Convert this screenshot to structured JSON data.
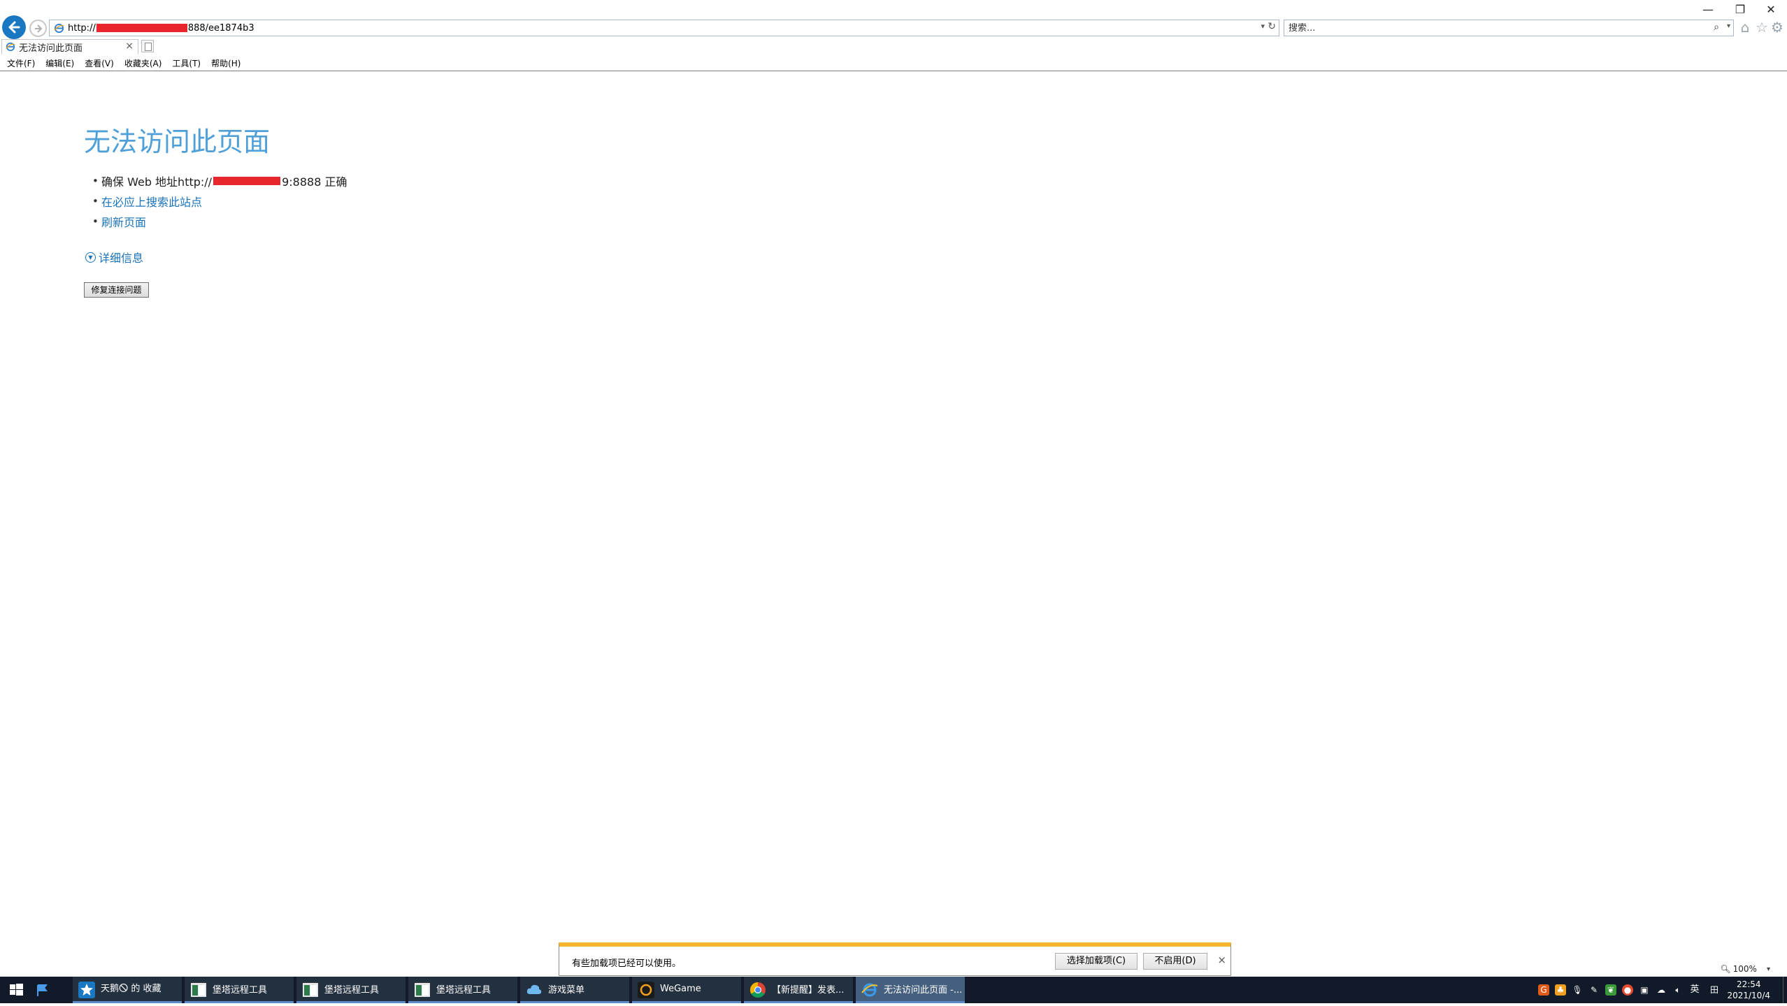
{
  "window": {
    "minimize": "—",
    "restore": "❐",
    "close": "✕"
  },
  "address_bar": {
    "url_prefix": "http://",
    "url_suffix": "888/ee1874b3"
  },
  "search": {
    "placeholder": "搜索..."
  },
  "tab": {
    "title": "无法访问此页面",
    "close": "×"
  },
  "menu": [
    "文件(F)",
    "编辑(E)",
    "查看(V)",
    "收藏夹(A)",
    "工具(T)",
    "帮助(H)"
  ],
  "content": {
    "title": "无法访问此页面",
    "bullet_1_prefix": "确保 Web 地址http://",
    "bullet_1_suffix": "9:8888 正确",
    "bullet_2": "在必应上搜索此站点",
    "bullet_3": "刷新页面",
    "details": "详细信息",
    "fix_button": "修复连接问题"
  },
  "zoom": {
    "label": "100%"
  },
  "notification": {
    "text": "有些加载项已经可以使用。",
    "choose_button": "选择加载项(C)",
    "disable_button": "不启用(D)",
    "close": "×"
  },
  "taskbar": {
    "tasks": [
      "天鹅🛇 的 收藏",
      "堡塔远程工具",
      "堡塔远程工具",
      "堡塔远程工具",
      "游戏菜单",
      "WeGame",
      "【新提醒】发表...",
      "无法访问此页面 -..."
    ],
    "tray_lang": "英",
    "time": "22:54",
    "date": "2021/10/4"
  },
  "colors": {
    "accent": "#1a78c2",
    "title_blue": "#4f9fd8",
    "link_blue": "#1a73b8",
    "notify_yellow": "#f4b32c",
    "taskbar": "#101a28"
  }
}
